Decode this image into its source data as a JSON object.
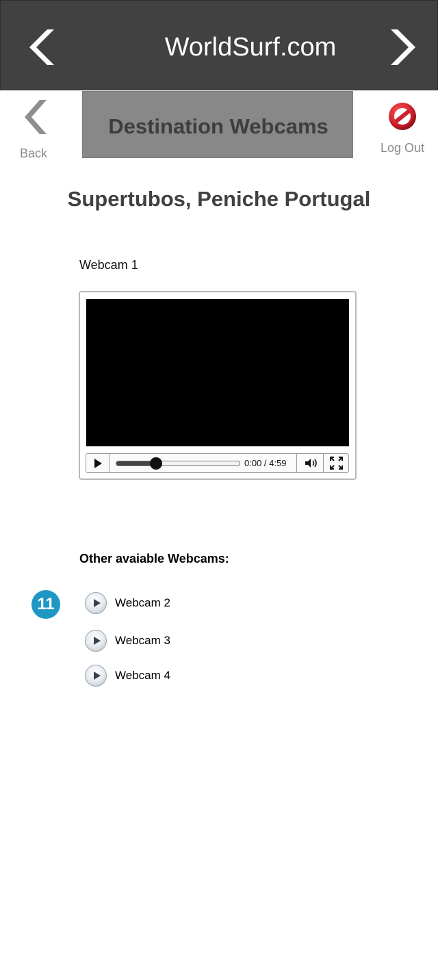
{
  "header": {
    "site_title": "WorldSurf.com",
    "prev_icon": "chevron-left-icon",
    "next_icon": "chevron-right-icon"
  },
  "subnav": {
    "back_label": "Back",
    "section_title": "Destination Webcams",
    "logout_label": "Log Out",
    "logout_icon": "no-entry-icon"
  },
  "destination": {
    "title": "Supertubos, Peniche Portugal"
  },
  "player": {
    "label": "Webcam 1",
    "time": "0:00 / 4:59",
    "progress": 0.32
  },
  "others": {
    "title": "Other avaiable Webcams:",
    "badge": "11",
    "items": [
      {
        "label": "Webcam 2"
      },
      {
        "label": "Webcam 3"
      },
      {
        "label": "Webcam 4"
      }
    ]
  },
  "colors": {
    "header_bg": "#414141",
    "tab_bg": "#888888",
    "badge": "#1f97c4",
    "logout_red": "#d0202a"
  }
}
